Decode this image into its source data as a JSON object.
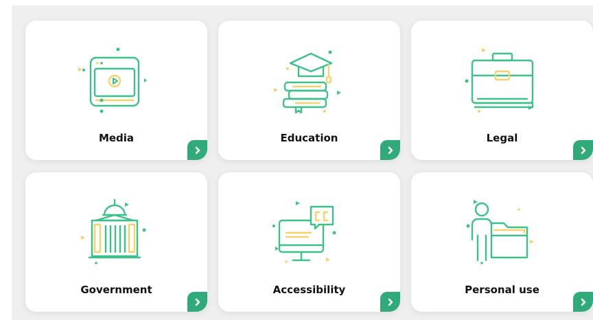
{
  "colors": {
    "accent": "#2faa78",
    "line": "#3cc08a",
    "highlight": "#f3d36a"
  },
  "cards": [
    {
      "label": "Media",
      "icon": "video-player-icon"
    },
    {
      "label": "Education",
      "icon": "graduation-books-icon"
    },
    {
      "label": "Legal",
      "icon": "briefcase-icon"
    },
    {
      "label": "Government",
      "icon": "capitol-building-icon"
    },
    {
      "label": "Accessibility",
      "icon": "closed-captions-monitor-icon"
    },
    {
      "label": "Personal use",
      "icon": "person-folder-icon"
    }
  ]
}
